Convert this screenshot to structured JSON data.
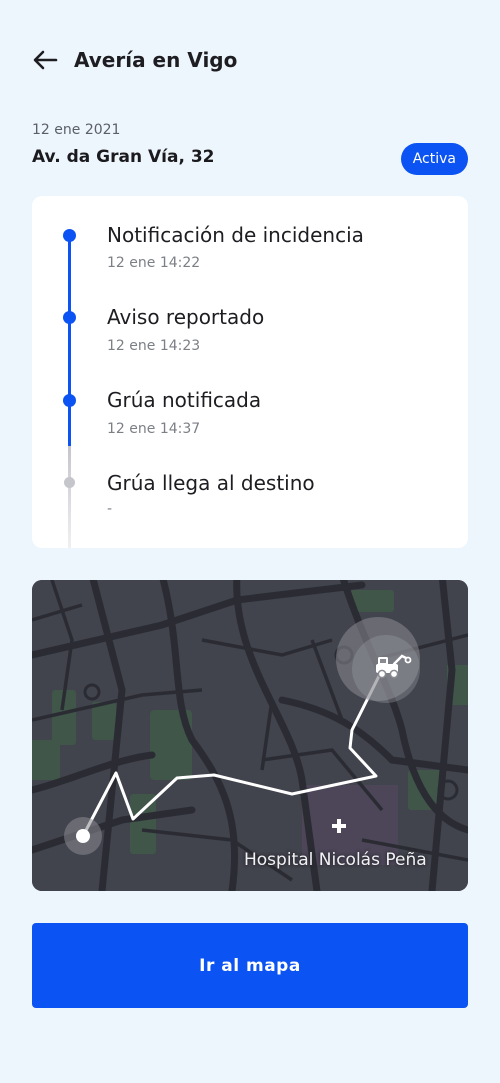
{
  "header": {
    "title": "Avería en Vigo",
    "back_icon": "arrow-left-icon"
  },
  "incident": {
    "date": "12 ene 2021",
    "address": "Av. da Gran Vía, 32",
    "status": "Activa"
  },
  "timeline": {
    "steps": [
      {
        "title": "Notificación de incidencia",
        "time": "12 ene 14:22",
        "completed": true
      },
      {
        "title": "Aviso reportado",
        "time": "12 ene 14:23",
        "completed": true
      },
      {
        "title": "Grúa notificada",
        "time": "12 ene 14:37",
        "completed": true
      },
      {
        "title": "Grúa llega al destino",
        "time": "-",
        "completed": false
      }
    ]
  },
  "map": {
    "poi_label": "Hospital Nicolás Peña",
    "poi_icon": "hospital-cross-icon",
    "vehicle_icon": "tow-truck-icon",
    "origin_icon": "origin-dot-icon"
  },
  "actions": {
    "go_to_map": "Ir al mapa"
  },
  "colors": {
    "accent": "#0b53f2",
    "background": "#eef6fd",
    "map_background": "#41434d",
    "timeline_inactive": "#c4c6cb"
  }
}
